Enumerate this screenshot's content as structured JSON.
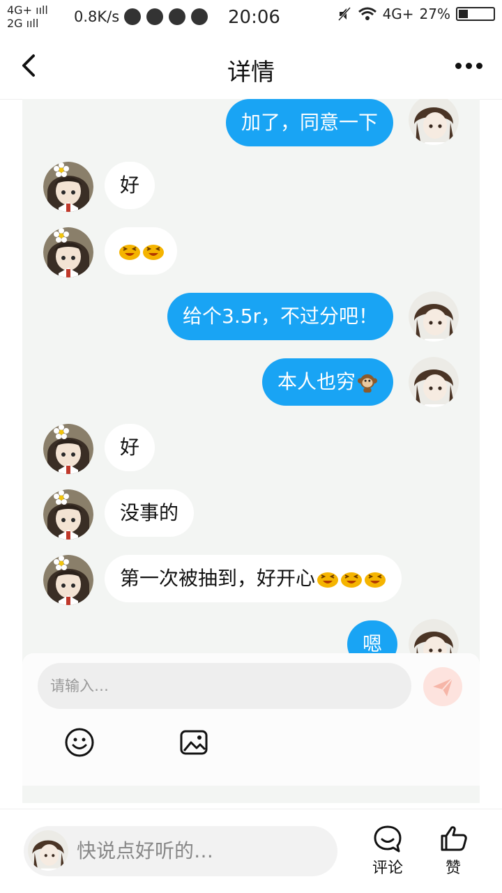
{
  "status_bar": {
    "net_top": "4G+ ııll",
    "net_bottom": "2G ııll",
    "speed": "0.8K/s",
    "time": "20:06",
    "network_right": "4G+",
    "battery_label": "27%",
    "battery_level": 0.27,
    "app_icons": [
      "play-circle-icon",
      "paint-icon",
      "wechat-icon",
      "message-icon"
    ]
  },
  "nav": {
    "title": "详情",
    "back_icon": "chevron-left-icon",
    "more_icon": "more-dots-icon"
  },
  "chat": {
    "messages": [
      {
        "side": "sent",
        "text": "加了，同意一下"
      },
      {
        "side": "recv",
        "text": "好"
      },
      {
        "side": "recv",
        "text": "",
        "emojis": [
          "laugh-emoji",
          "laugh-emoji"
        ]
      },
      {
        "side": "sent",
        "text": "给个3.5r，不过分吧！"
      },
      {
        "side": "sent",
        "text": "本人也穷",
        "emojis": [
          "monkey-emoji"
        ]
      },
      {
        "side": "recv",
        "text": "好"
      },
      {
        "side": "recv",
        "text": "没事的"
      },
      {
        "side": "recv",
        "text": "第一次被抽到，好开心",
        "emojis": [
          "laugh-emoji",
          "laugh-emoji",
          "laugh-emoji"
        ]
      },
      {
        "side": "sent",
        "text": "嗯"
      }
    ],
    "input_placeholder": "请输入…",
    "send_icon": "paper-plane-icon",
    "tools": [
      "smiley-icon",
      "image-icon"
    ]
  },
  "bottom_bar": {
    "comment_placeholder": "快说点好听的…",
    "comment_label": "评论",
    "like_label": "赞"
  },
  "colors": {
    "sent_bubble": "#19a4f4",
    "recv_bubble": "#ffffff",
    "chat_bg": "#f3f5f3"
  }
}
